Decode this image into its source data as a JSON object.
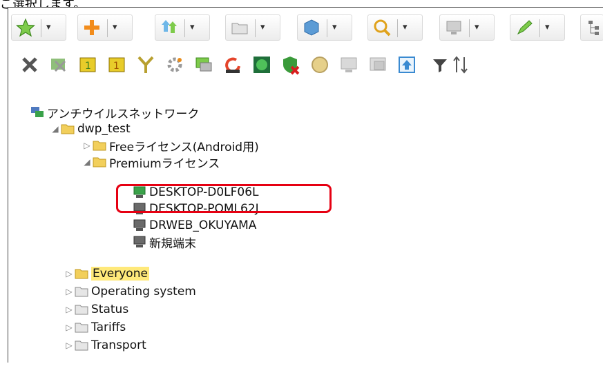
{
  "caption": "ご選択します。",
  "tree": {
    "root": "アンチウイルスネットワーク",
    "group": "dwp_test",
    "children": [
      "Freeライセンス(Android用)",
      "Premiumライセンス"
    ],
    "stations": [
      "DESKTOP-D0LF06L",
      "DESKTOP-POML62J",
      "DRWEB_OKUYAMA",
      "新規端末"
    ],
    "folders": [
      "Everyone",
      "Operating system",
      "Status",
      "Tariffs",
      "Transport"
    ]
  },
  "icons": {
    "toolbar1": [
      "star-icon",
      "add-icon",
      "install-icon",
      "folder-icon",
      "component-icon",
      "search-icon",
      "monitor-icon",
      "edit-icon",
      "tree-icon"
    ],
    "toolbar2": [
      "delete-icon",
      "remove-icon",
      "group-icon",
      "group-alt-icon",
      "merge-icon",
      "settings-icon",
      "sync-icon",
      "restart-icon",
      "update-icon",
      "scan-icon",
      "shield-icon",
      "status-icon",
      "log-icon",
      "upload-icon",
      "filter-icon",
      "sort-icon"
    ]
  },
  "colors": {
    "highlight": "#e60012",
    "selected_bg": "#ffe97a"
  }
}
